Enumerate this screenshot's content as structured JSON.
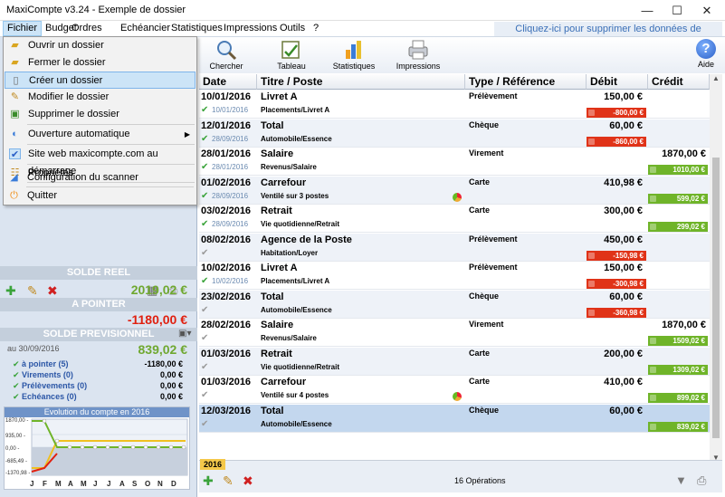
{
  "window": {
    "title": "MaxiCompte v3.24 - Exemple de dossier",
    "minimize": "—",
    "maximize": "☐",
    "close": "✕"
  },
  "menu": [
    "Fichier",
    "Budget",
    "Ordres",
    "Echéancier",
    "Statistiques",
    "Impressions",
    "Outils",
    "?"
  ],
  "demo_banner": "Cliquez-ici pour supprimer les données de démonstration",
  "toolbar": {
    "search": "Chercher",
    "table": "Tableau",
    "stats": "Statistiques",
    "print": "Impressions",
    "help": "Aide"
  },
  "file_menu": [
    {
      "label": "Ouvrir un dossier",
      "icon": "folder-open-icon"
    },
    {
      "label": "Fermer le dossier",
      "icon": "folder-close-icon"
    },
    {
      "label": "Créer un dossier",
      "icon": "new-file-icon"
    },
    {
      "label": "Modifier le dossier",
      "icon": "edit-file-icon"
    },
    {
      "label": "Supprimer le dossier",
      "icon": "delete-file-icon"
    },
    {
      "label": "Ouverture automatique",
      "icon": "auto-open-icon"
    },
    {
      "label": "Site web maxicompte.com au démarrage",
      "icon": "check-icon"
    },
    {
      "label": "Propriétés",
      "icon": "properties-icon"
    },
    {
      "label": "Configuration du scanner",
      "icon": "scanner-icon"
    },
    {
      "label": "Quitter",
      "icon": "power-icon"
    }
  ],
  "columns": [
    "Date",
    "Titre / Poste",
    "Type / Référence",
    "Débit",
    "Crédit"
  ],
  "rows": [
    {
      "date": "10/01/2016",
      "sub": "10/01/2016",
      "t1": "Livret A",
      "t2": "Placements/Livret A",
      "type": "Prélèvement",
      "debit": "150,00 €",
      "credit": "",
      "bal": "-800,00 €",
      "neg": true,
      "pie": false,
      "done": true
    },
    {
      "date": "12/01/2016",
      "sub": "28/09/2016",
      "t1": "Total",
      "t2": "Automobile/Essence",
      "type": "Chèque",
      "debit": "60,00 €",
      "credit": "",
      "bal": "-860,00 €",
      "neg": true,
      "pie": false,
      "done": true
    },
    {
      "date": "28/01/2016",
      "sub": "28/01/2016",
      "t1": "Salaire",
      "t2": "Revenus/Salaire",
      "type": "Virement",
      "debit": "",
      "credit": "1870,00 €",
      "bal": "1010,00 €",
      "neg": false,
      "pie": false,
      "done": true
    },
    {
      "date": "01/02/2016",
      "sub": "28/09/2016",
      "t1": "Carrefour",
      "t2": "Ventilé sur 3 postes",
      "type": "Carte",
      "debit": "410,98 €",
      "credit": "",
      "bal": "599,02 €",
      "neg": false,
      "pie": true,
      "done": true
    },
    {
      "date": "03/02/2016",
      "sub": "28/09/2016",
      "t1": "Retrait",
      "t2": "Vie quotidienne/Retrait",
      "type": "Carte",
      "debit": "300,00 €",
      "credit": "",
      "bal": "299,02 €",
      "neg": false,
      "pie": false,
      "done": true
    },
    {
      "date": "08/02/2016",
      "sub": "",
      "t1": "Agence de la Poste",
      "t2": "Habitation/Loyer",
      "type": "Prélèvement",
      "debit": "450,00 €",
      "credit": "",
      "bal": "-150,98 €",
      "neg": true,
      "pie": false,
      "done": false
    },
    {
      "date": "10/02/2016",
      "sub": "10/02/2016",
      "t1": "Livret A",
      "t2": "Placements/Livret A",
      "type": "Prélèvement",
      "debit": "150,00 €",
      "credit": "",
      "bal": "-300,98 €",
      "neg": true,
      "pie": false,
      "done": true
    },
    {
      "date": "23/02/2016",
      "sub": "",
      "t1": "Total",
      "t2": "Automobile/Essence",
      "type": "Chèque",
      "debit": "60,00 €",
      "credit": "",
      "bal": "-360,98 €",
      "neg": true,
      "pie": false,
      "done": false
    },
    {
      "date": "28/02/2016",
      "sub": "",
      "t1": "Salaire",
      "t2": "Revenus/Salaire",
      "type": "Virement",
      "debit": "",
      "credit": "1870,00 €",
      "bal": "1509,02 €",
      "neg": false,
      "pie": false,
      "done": false
    },
    {
      "date": "01/03/2016",
      "sub": "",
      "t1": "Retrait",
      "t2": "Vie quotidienne/Retrait",
      "type": "Carte",
      "debit": "200,00 €",
      "credit": "",
      "bal": "1309,02 €",
      "neg": false,
      "pie": false,
      "done": false
    },
    {
      "date": "01/03/2016",
      "sub": "",
      "t1": "Carrefour",
      "t2": "Ventilé sur 4 postes",
      "type": "Carte",
      "debit": "410,00 €",
      "credit": "",
      "bal": "899,02 €",
      "neg": false,
      "pie": true,
      "done": false
    },
    {
      "date": "12/03/2016",
      "sub": "",
      "t1": "Total",
      "t2": "Automobile/Essence",
      "type": "Chèque",
      "debit": "60,00 €",
      "credit": "",
      "bal": "839,02 €",
      "neg": false,
      "pie": false,
      "done": false
    }
  ],
  "left": {
    "solde_reel_label": "SOLDE REEL",
    "solde_reel": "2019,02 €",
    "a_pointer_label": "A POINTER",
    "a_pointer": "-1180,00 €",
    "solde_prev_label": "SOLDE PREVISIONNEL",
    "prev_date": "au 30/09/2016",
    "solde_prev": "839,02 €",
    "items": [
      {
        "label": "à pointer (5)",
        "value": "-1180,00 €"
      },
      {
        "label": "Virements (0)",
        "value": "0,00 €"
      },
      {
        "label": "Prélèvements (0)",
        "value": "0,00 €"
      },
      {
        "label": "Echéances (0)",
        "value": "0,00 €"
      }
    ],
    "chart_title": "Evolution du compte en 2016",
    "chart_y": [
      "1870,00 -",
      "935,00 -",
      "0,00 -",
      "-685,49 -",
      "-1370,98 -"
    ],
    "chart_months": [
      "J",
      "F",
      "M",
      "A",
      "M",
      "J",
      "J",
      "A",
      "S",
      "O",
      "N",
      "D"
    ]
  },
  "footer": {
    "year": "2016",
    "count": "16 Opérations"
  },
  "colors": {
    "neg": "#e03318",
    "pos": "#6fb429",
    "accent": "#3a6fb7"
  }
}
